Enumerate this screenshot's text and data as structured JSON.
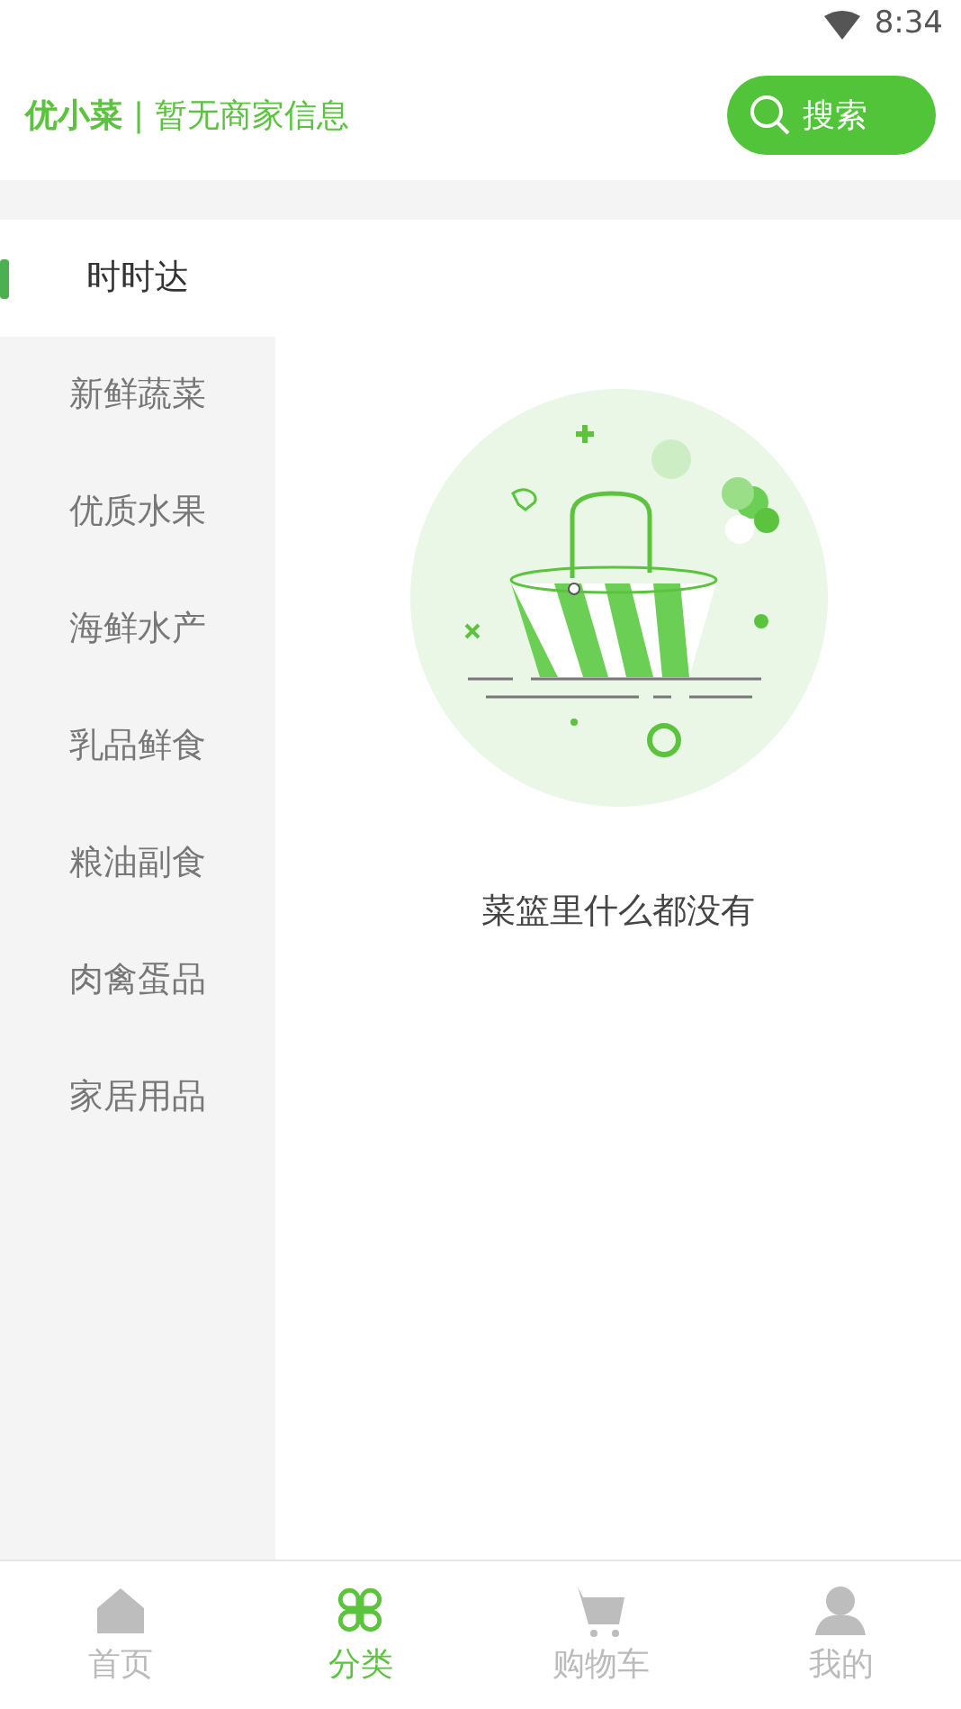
{
  "status_bar": {
    "time": "8:34"
  },
  "header": {
    "brand": "优小菜",
    "separator": "|",
    "merchant": "暂无商家信息",
    "search_button": "搜索"
  },
  "categories": [
    {
      "label": "时时达",
      "selected": true
    },
    {
      "label": "新鲜蔬菜",
      "selected": false
    },
    {
      "label": "优质水果",
      "selected": false
    },
    {
      "label": "海鲜水产",
      "selected": false
    },
    {
      "label": "乳品鲜食",
      "selected": false
    },
    {
      "label": "粮油副食",
      "selected": false
    },
    {
      "label": "肉禽蛋品",
      "selected": false
    },
    {
      "label": "家居用品",
      "selected": false
    }
  ],
  "empty_state": {
    "message": "菜篮里什么都没有"
  },
  "tabs": [
    {
      "label": "首页",
      "kind": "home",
      "selected": false
    },
    {
      "label": "分类",
      "kind": "category",
      "selected": true
    },
    {
      "label": "购物车",
      "kind": "cart",
      "selected": false
    },
    {
      "label": "我的",
      "kind": "profile",
      "selected": false
    }
  ]
}
